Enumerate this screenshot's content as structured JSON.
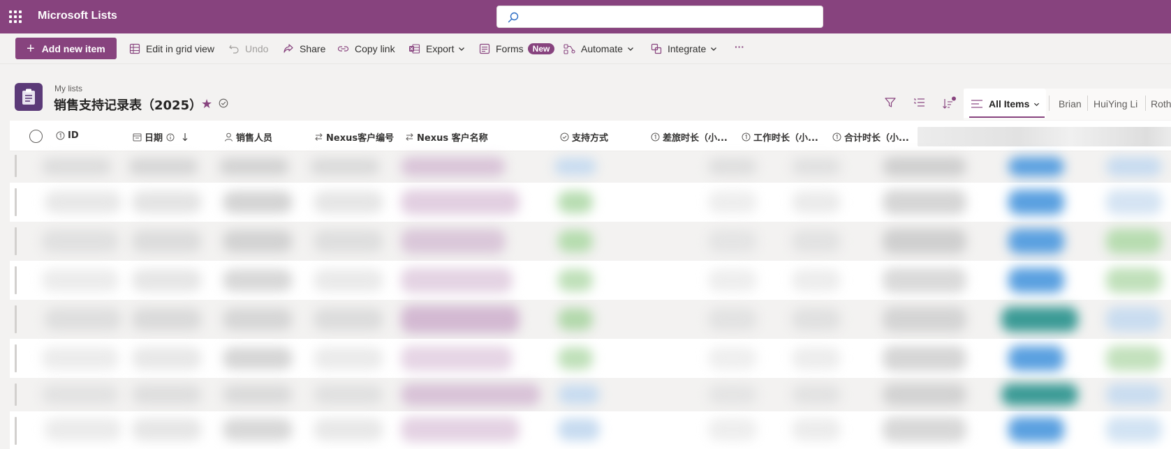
{
  "app": {
    "title": "Microsoft Lists",
    "search_value": "",
    "search_placeholder": ""
  },
  "commandbar": {
    "add_label": "Add new item",
    "edit_grid_label": "Edit in grid view",
    "undo_label": "Undo",
    "share_label": "Share",
    "copy_link_label": "Copy link",
    "export_label": "Export",
    "forms_label": "Forms",
    "forms_badge": "New",
    "automate_label": "Automate",
    "integrate_label": "Integrate",
    "more_label": "···"
  },
  "list": {
    "breadcrumb": "My lists",
    "title": "销售支持记录表（2025）",
    "favorite_glyph": "★"
  },
  "views": {
    "active": "All Items",
    "others": [
      "Brian",
      "HuiYing Li",
      "Roth"
    ]
  },
  "columns": [
    {
      "label": "ID",
      "icon": "number-icon"
    },
    {
      "label": "日期",
      "icon": "calendar-icon"
    },
    {
      "label": "销售人员",
      "icon": "person-icon"
    },
    {
      "label": "Nexus客户编号",
      "icon": "lookup-icon"
    },
    {
      "label": "Nexus 客户名称",
      "icon": "lookup-icon"
    },
    {
      "label": "支持方式",
      "icon": "choice-icon"
    },
    {
      "label": "差旅时长（小...",
      "icon": "number-icon"
    },
    {
      "label": "工作时长（小...",
      "icon": "number-icon"
    },
    {
      "label": "合计时长（小...",
      "icon": "number-icon"
    }
  ],
  "colors": {
    "brand": "#87437e",
    "choice_blue": "#5aa0e0",
    "choice_green": "#a8d5a0",
    "choice_teal": "#3a9a95",
    "customer_pink": "#d9c4d8"
  }
}
